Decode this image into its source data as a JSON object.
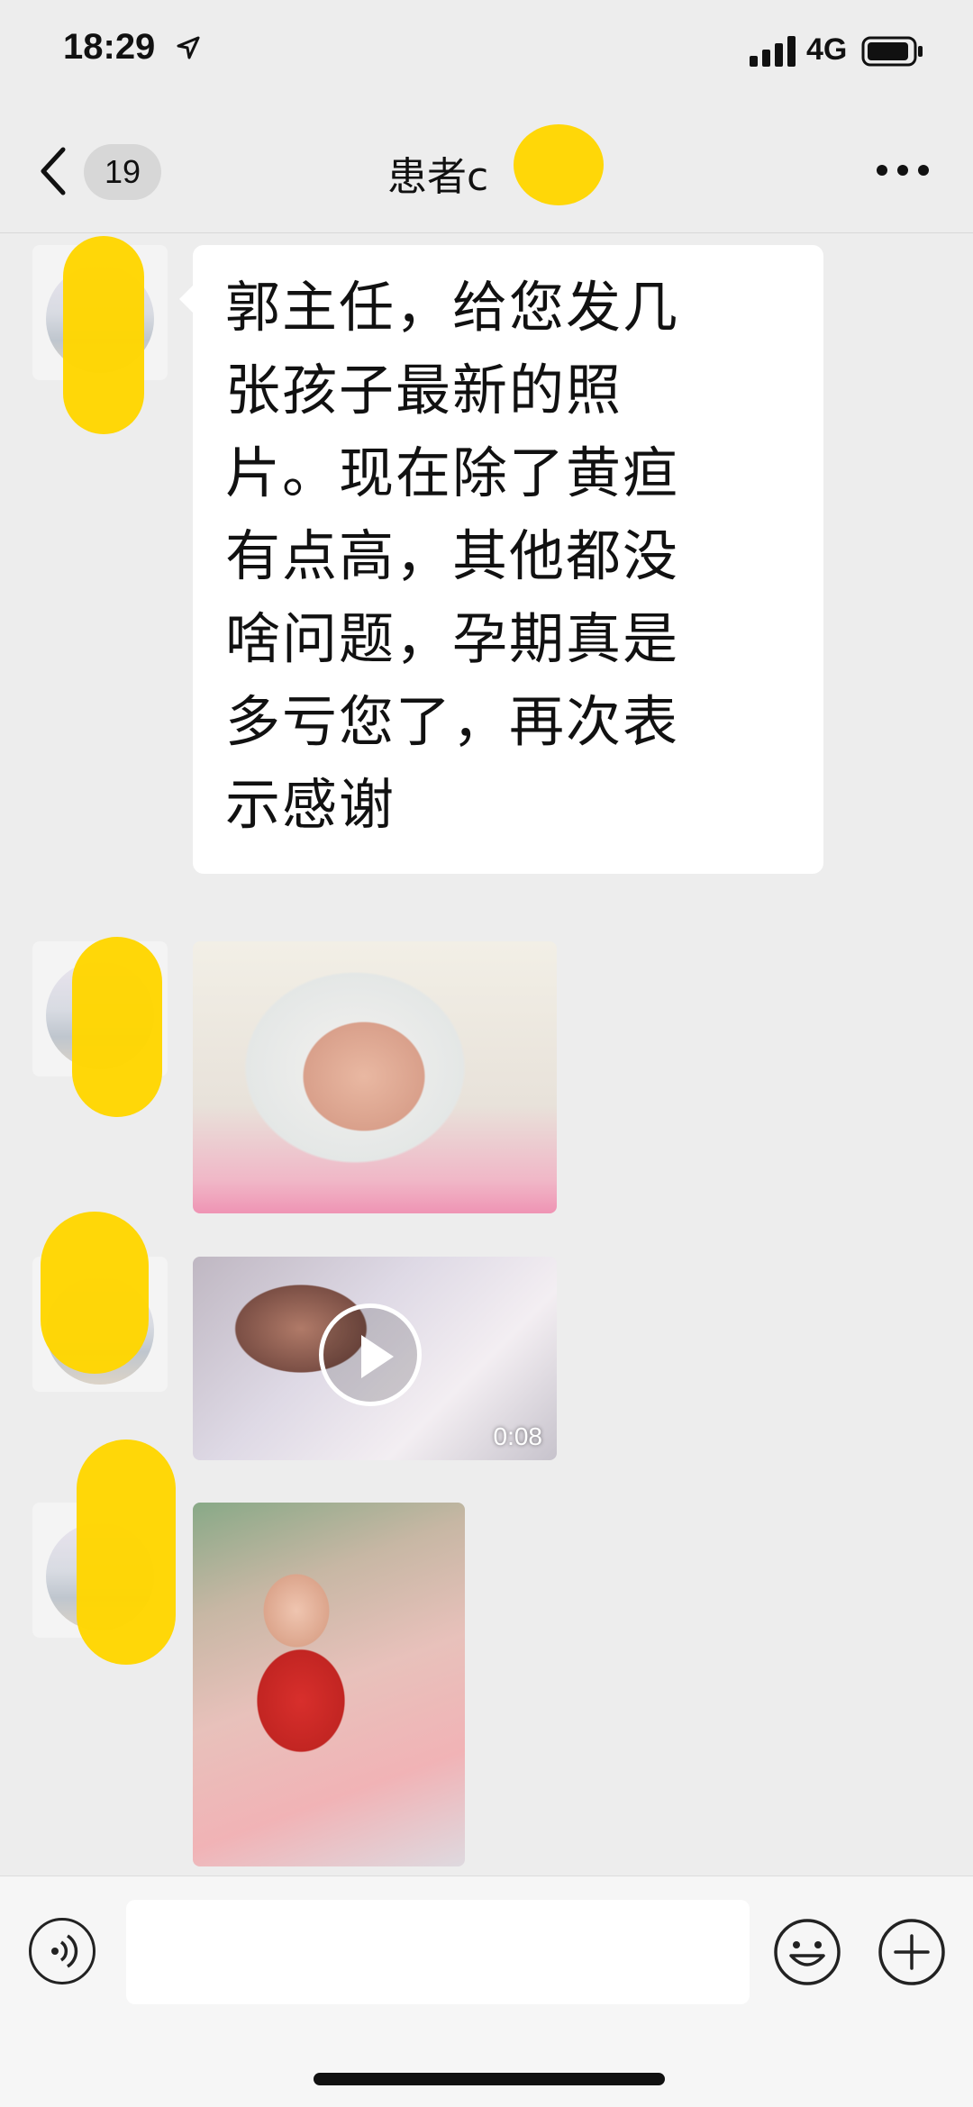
{
  "status_bar": {
    "time": "18:29",
    "network": "4G",
    "icons": [
      "location-arrow-icon",
      "signal-bars-icon",
      "battery-icon"
    ]
  },
  "nav": {
    "back_icon": "chevron-left-icon",
    "unread_count": "19",
    "title": "患者c",
    "more_icon": "more-dots-icon"
  },
  "messages": [
    {
      "type": "text",
      "text_lines": [
        "郭主任，给您发几",
        "张孩子最新的照",
        "片。现在除了黄疸",
        "有点高，其他都没",
        "啥问题，孕期真是",
        "多亏您了，再次表",
        "示感谢"
      ]
    },
    {
      "type": "image"
    },
    {
      "type": "video",
      "duration": "0:08"
    },
    {
      "type": "image"
    }
  ],
  "input_bar": {
    "voice_icon": "voice-icon",
    "emoji_icon": "emoji-icon",
    "plus_icon": "plus-icon",
    "placeholder": ""
  },
  "colors": {
    "background": "#ededed",
    "bubble": "#ffffff",
    "redaction": "#ffd600"
  }
}
